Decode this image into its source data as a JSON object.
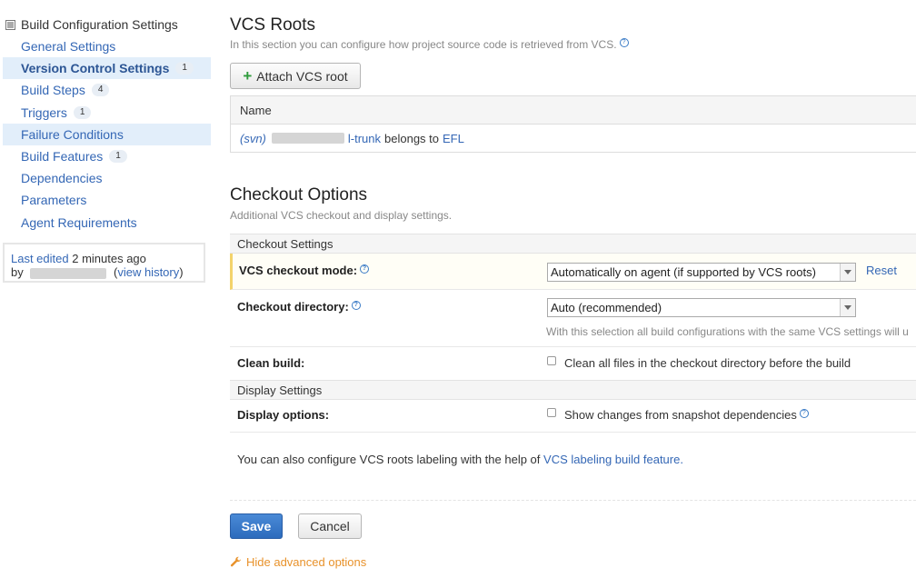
{
  "sidebar": {
    "header": "Build Configuration Settings",
    "items": [
      {
        "label": "General Settings",
        "count": ""
      },
      {
        "label": "Version Control Settings",
        "count": "1"
      },
      {
        "label": "Build Steps",
        "count": "4"
      },
      {
        "label": "Triggers",
        "count": "1"
      },
      {
        "label": "Failure Conditions",
        "count": ""
      },
      {
        "label": "Build Features",
        "count": "1"
      },
      {
        "label": "Dependencies",
        "count": ""
      },
      {
        "label": "Parameters",
        "count": ""
      },
      {
        "label": "Agent Requirements",
        "count": ""
      }
    ],
    "last_edited_link": "Last edited",
    "last_edited_time": "2 minutes ago",
    "by_label": "by",
    "view_history": "view history"
  },
  "vcs_roots": {
    "title": "VCS Roots",
    "description": "In this section you can configure how project source code is retrieved from VCS.",
    "attach_button": "Attach VCS root",
    "table_header": "Name",
    "root": {
      "type": "(svn)",
      "name_suffix": "l-trunk",
      "belongs_to": "belongs to",
      "project": "EFL"
    }
  },
  "checkout_options": {
    "title": "Checkout Options",
    "description": "Additional VCS checkout and display settings.",
    "checkout_settings_header": "Checkout Settings",
    "vcs_checkout_mode": {
      "label": "VCS checkout mode:",
      "value": "Automatically on agent (if supported by VCS roots)",
      "reset": "Reset"
    },
    "checkout_directory": {
      "label": "Checkout directory:",
      "value": "Auto (recommended)",
      "note": "With this selection all build configurations with the same VCS settings will u"
    },
    "clean_build": {
      "label": "Clean build:",
      "checkbox_label": "Clean all files in the checkout directory before the build",
      "checked": false
    },
    "display_settings_header": "Display Settings",
    "display_options": {
      "label": "Display options:",
      "checkbox_label": "Show changes from snapshot dependencies",
      "checked": false
    },
    "labeling_text": "You can also configure VCS roots labeling with the help of",
    "labeling_link": "VCS labeling build feature."
  },
  "actions": {
    "save": "Save",
    "cancel": "Cancel",
    "hide_advanced": "Hide advanced options"
  },
  "colors": {
    "link": "#3467b5",
    "active_bg": "#e2eefa",
    "primary_button": "#2c6bbd",
    "highlight_border": "#f3d36b",
    "advanced_link": "#e8922b"
  }
}
